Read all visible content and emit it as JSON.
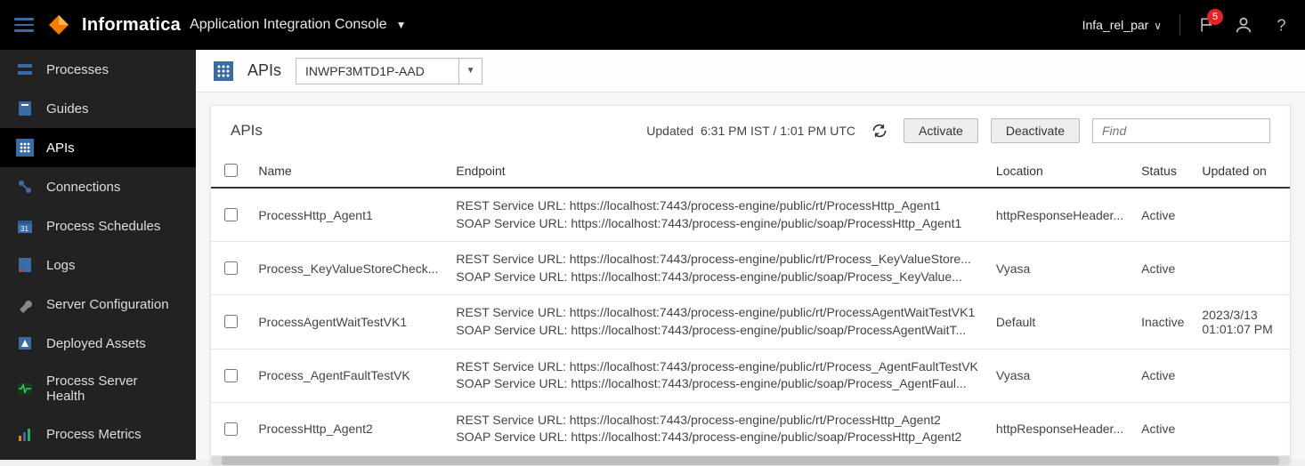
{
  "header": {
    "brand": "Informatica",
    "product": "Application Integration Console",
    "org": "Infa_rel_par",
    "notif_count": "5",
    "icons": {
      "hamburger": "hamburger-icon",
      "logo": "logo-icon",
      "chevron": "chevron-down-icon",
      "flag": "flag-icon",
      "user": "user-icon",
      "help": "help-icon"
    }
  },
  "sidebar": {
    "items": [
      {
        "label": "Processes",
        "name": "sidebar-item-processes",
        "icon": "processes-icon"
      },
      {
        "label": "Guides",
        "name": "sidebar-item-guides",
        "icon": "guides-icon"
      },
      {
        "label": "APIs",
        "name": "sidebar-item-apis",
        "icon": "apis-icon",
        "active": true
      },
      {
        "label": "Connections",
        "name": "sidebar-item-connections",
        "icon": "connections-icon"
      },
      {
        "label": "Process Schedules",
        "name": "sidebar-item-schedules",
        "icon": "calendar-icon"
      },
      {
        "label": "Logs",
        "name": "sidebar-item-logs",
        "icon": "logs-icon"
      },
      {
        "label": "Server Configuration",
        "name": "sidebar-item-serverconfig",
        "icon": "wrench-icon"
      },
      {
        "label": "Deployed Assets",
        "name": "sidebar-item-deployed",
        "icon": "assets-icon"
      },
      {
        "label": "Process Server Health",
        "name": "sidebar-item-health",
        "icon": "heartbeat-icon"
      },
      {
        "label": "Process Metrics",
        "name": "sidebar-item-metrics",
        "icon": "chart-icon"
      }
    ]
  },
  "toolstrip": {
    "title": "APIs",
    "server_value": "INWPF3MTD1P-AAD"
  },
  "panel": {
    "title": "APIs",
    "updated_label": "Updated",
    "updated_time": "6:31 PM IST / 1:01 PM UTC",
    "activate_label": "Activate",
    "deactivate_label": "Deactivate",
    "find_placeholder": "Find"
  },
  "table": {
    "headers": {
      "name": "Name",
      "endpoint": "Endpoint",
      "location": "Location",
      "status": "Status",
      "updated": "Updated on"
    },
    "rows": [
      {
        "name": "ProcessHttp_Agent1",
        "rest": "REST Service URL: https://localhost:7443/process-engine/public/rt/ProcessHttp_Agent1",
        "soap": "SOAP Service URL: https://localhost:7443/process-engine/public/soap/ProcessHttp_Agent1",
        "location": "httpResponseHeader...",
        "status": "Active",
        "updated": ""
      },
      {
        "name": "Process_KeyValueStoreCheck...",
        "rest": "REST Service URL: https://localhost:7443/process-engine/public/rt/Process_KeyValueStore...",
        "soap": "SOAP Service URL: https://localhost:7443/process-engine/public/soap/Process_KeyValue...",
        "location": "Vyasa",
        "status": "Active",
        "updated": ""
      },
      {
        "name": "ProcessAgentWaitTestVK1",
        "rest": "REST Service URL: https://localhost:7443/process-engine/public/rt/ProcessAgentWaitTestVK1",
        "soap": "SOAP Service URL: https://localhost:7443/process-engine/public/soap/ProcessAgentWaitT...",
        "location": "Default",
        "status": "Inactive",
        "updated": "2023/3/13 01:01:07 PM"
      },
      {
        "name": "Process_AgentFaultTestVK",
        "rest": "REST Service URL: https://localhost:7443/process-engine/public/rt/Process_AgentFaultTestVK",
        "soap": "SOAP Service URL: https://localhost:7443/process-engine/public/soap/Process_AgentFaul...",
        "location": "Vyasa",
        "status": "Active",
        "updated": ""
      },
      {
        "name": "ProcessHttp_Agent2",
        "rest": "REST Service URL: https://localhost:7443/process-engine/public/rt/ProcessHttp_Agent2",
        "soap": "SOAP Service URL: https://localhost:7443/process-engine/public/soap/ProcessHttp_Agent2",
        "location": "httpResponseHeader...",
        "status": "Active",
        "updated": ""
      }
    ]
  }
}
